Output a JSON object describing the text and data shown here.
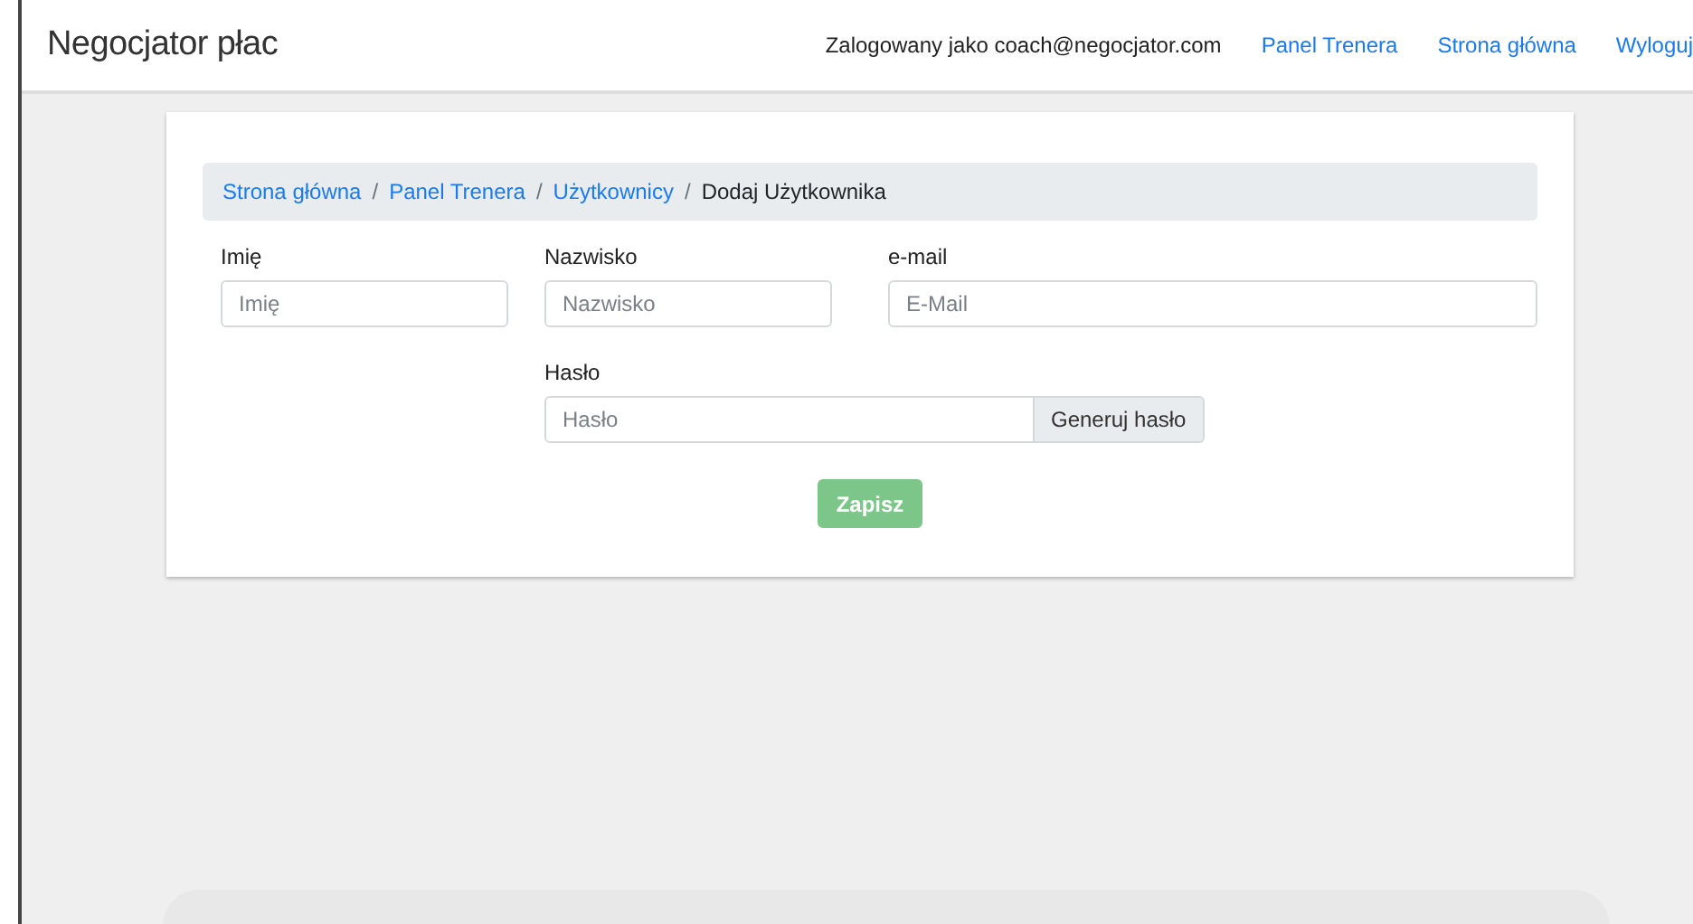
{
  "navbar": {
    "brand": "Negocjator płac",
    "user_text": "Zalogowany jako coach@negocjator.com",
    "links": [
      {
        "label": "Panel Trenera"
      },
      {
        "label": "Strona główna"
      },
      {
        "label": "Wyloguj"
      }
    ]
  },
  "breadcrumb": [
    {
      "label": "Strona główna",
      "link": true
    },
    {
      "separator": "/",
      "label": "Panel Trenera",
      "link": true
    },
    {
      "separator": "/",
      "label": "Użytkownicy",
      "link": true
    },
    {
      "separator": "/",
      "label": "Dodaj Użytkownika",
      "link": false
    }
  ],
  "fields": [
    {
      "label": "Imię",
      "placeholder": "Imię"
    },
    {
      "label": "Nazwisko",
      "placeholder": "Nazwisko"
    },
    {
      "label": "e-mail",
      "placeholder": "E-Mail"
    }
  ],
  "password": {
    "label": "Hasło",
    "placeholder": "Hasło",
    "button": "Generuj hasło"
  },
  "submit": {
    "label": "Zapisz",
    "disabled": true
  }
}
